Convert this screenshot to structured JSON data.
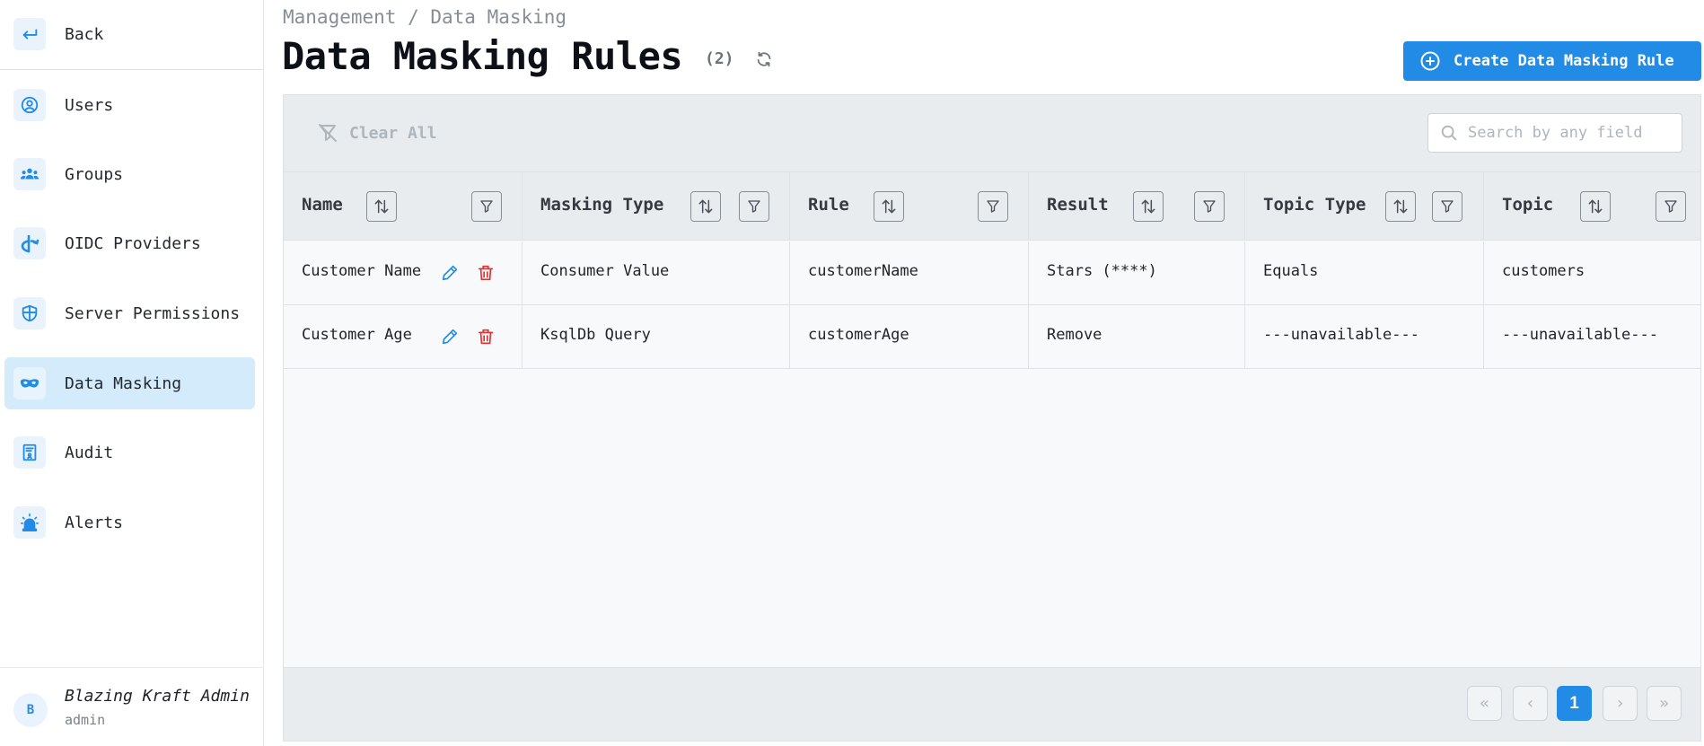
{
  "sidebar": {
    "back_label": "Back",
    "items": [
      {
        "label": "Users",
        "icon": "user-circle-icon"
      },
      {
        "label": "Groups",
        "icon": "users-group-icon"
      },
      {
        "label": "OIDC Providers",
        "icon": "oidc-icon"
      },
      {
        "label": "Server Permissions",
        "icon": "shield-icon"
      },
      {
        "label": "Data Masking",
        "icon": "mask-icon",
        "active": true
      },
      {
        "label": "Audit",
        "icon": "audit-report-icon"
      },
      {
        "label": "Alerts",
        "icon": "siren-icon"
      }
    ],
    "user": {
      "initial": "B",
      "name": "Blazing Kraft Admin",
      "role": "admin"
    }
  },
  "header": {
    "breadcrumb": "Management / Data Masking",
    "title": "Data Masking Rules",
    "count": "(2)",
    "create_button": "Create Data Masking Rule"
  },
  "toolbar": {
    "clear_all": "Clear All",
    "search_placeholder": "Search by any field"
  },
  "table": {
    "columns": [
      "Name",
      "Masking Type",
      "Rule",
      "Result",
      "Topic Type",
      "Topic"
    ],
    "rows": [
      {
        "name": "Customer Name",
        "masking_type": "Consumer Value",
        "rule": "customerName",
        "result": "Stars (****)",
        "topic_type": "Equals",
        "topic": "customers"
      },
      {
        "name": "Customer Age",
        "masking_type": "KsqlDb Query",
        "rule": "customerAge",
        "result": "Remove",
        "topic_type": "---unavailable---",
        "topic": "---unavailable---"
      }
    ]
  },
  "pagination": {
    "first": "«",
    "prev": "‹",
    "current": "1",
    "next": "›",
    "last": "»"
  },
  "colors": {
    "accent": "#228be6",
    "active_nav": "#d3ebfb",
    "danger": "#e03131"
  }
}
